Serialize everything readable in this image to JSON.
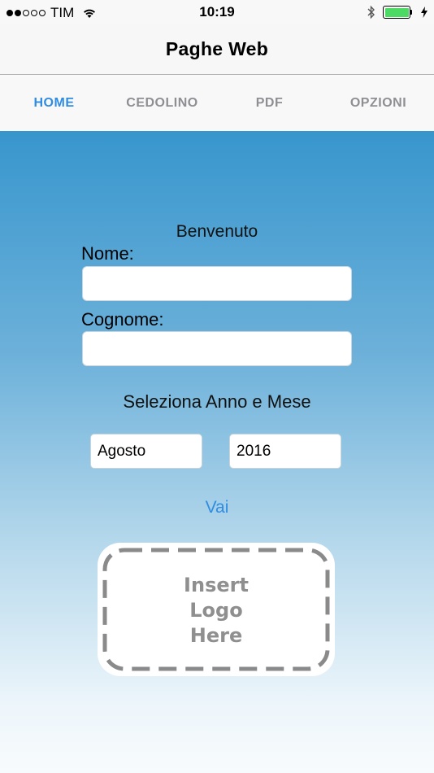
{
  "status_bar": {
    "carrier": "TIM",
    "time": "10:19",
    "signal_bars_filled": 2,
    "signal_bars_total": 5,
    "battery_level": 1.0,
    "icons": [
      "wifi-icon",
      "bluetooth-icon",
      "battery-icon",
      "charging-icon"
    ]
  },
  "nav": {
    "title": "Paghe Web"
  },
  "tabs": [
    {
      "label": "HOME",
      "active": true
    },
    {
      "label": "CEDOLINO",
      "active": false
    },
    {
      "label": "PDF",
      "active": false
    },
    {
      "label": "OPZIONI",
      "active": false
    }
  ],
  "form": {
    "welcome": "Benvenuto",
    "first_name_label": "Nome:",
    "first_name_value": "",
    "last_name_label": "Cognome:",
    "last_name_value": "",
    "select_prompt": "Seleziona Anno e Mese",
    "month_value": "Agosto",
    "year_value": "2016",
    "go_label": "Vai"
  },
  "logo": {
    "lines": [
      "Insert",
      "Logo",
      "Here"
    ]
  },
  "colors": {
    "accent": "#2f8ce0",
    "gradient_top": "#3896cd",
    "gradient_bottom": "#f8fbfd",
    "inactive_tab": "#8e8e93"
  }
}
